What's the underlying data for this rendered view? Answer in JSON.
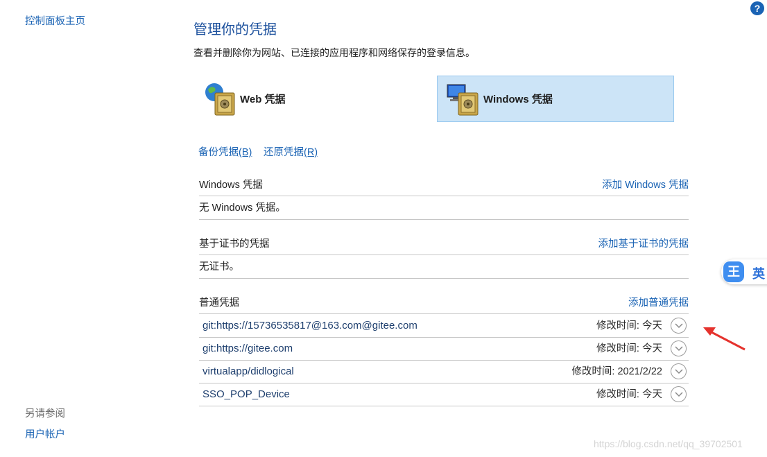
{
  "sidebar": {
    "home_label": "控制面板主页",
    "see_also_label": "另请参阅",
    "user_accounts_label": "用户帐户"
  },
  "help": {
    "label": "?"
  },
  "header": {
    "title": "管理你的凭据",
    "description": "查看并删除你为网站、已连接的应用程序和网络保存的登录信息。"
  },
  "tiles": {
    "web_label": "Web 凭据",
    "windows_label": "Windows 凭据",
    "selected": "windows"
  },
  "tools": {
    "backup_label": "备份凭据",
    "backup_key": "(B)",
    "restore_label": "还原凭据",
    "restore_key": "(R)"
  },
  "sections": {
    "windows": {
      "title": "Windows 凭据",
      "add_label": "添加 Windows 凭据",
      "empty_text": "无 Windows 凭据。"
    },
    "certificate": {
      "title": "基于证书的凭据",
      "add_label": "添加基于证书的凭据",
      "empty_text": "无证书。"
    },
    "generic": {
      "title": "普通凭据",
      "add_label": "添加普通凭据",
      "items": [
        {
          "name": "git:https://15736535817@163.com@gitee.com",
          "modified": "修改时间:  今天"
        },
        {
          "name": "git:https://gitee.com",
          "modified": "修改时间:  今天"
        },
        {
          "name": "virtualapp/didlogical",
          "modified": "修改时间:  2021/2/22"
        },
        {
          "name": "SSO_POP_Device",
          "modified": "修改时间:  今天"
        }
      ]
    }
  },
  "ime": {
    "logo": "王",
    "lang": "英"
  },
  "watermark": "https://blog.csdn.net/qq_39702501",
  "colors": {
    "link": "#1a63b4",
    "selected_tile": "#cce4f7",
    "annotation_arrow": "#e5322d"
  }
}
